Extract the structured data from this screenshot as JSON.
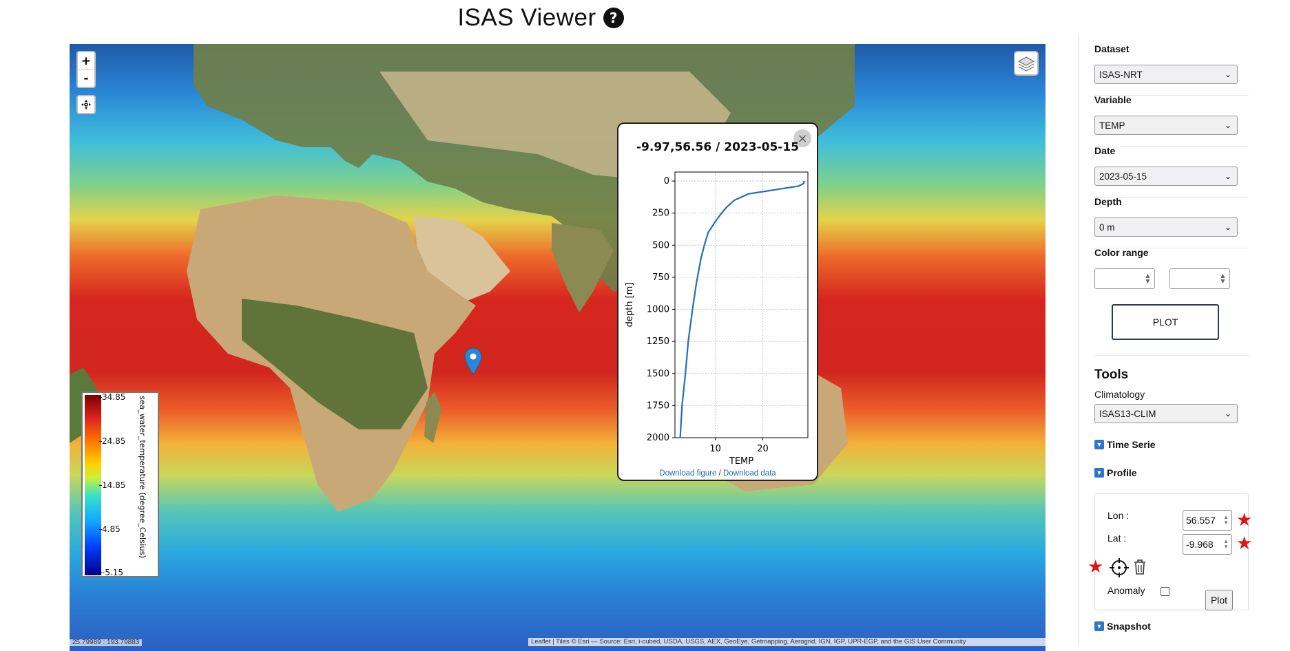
{
  "header": {
    "title": "ISAS Viewer",
    "help_icon": "?"
  },
  "map": {
    "zoom_in": "+",
    "zoom_out": "-",
    "legend": {
      "variable_label": "sea_water_temperature (degree_Celsius)",
      "ticks": [
        "34.85",
        "24.85",
        "14.85",
        "4.85",
        "-5.15"
      ]
    },
    "popup": {
      "title": "-9.97,56.56 / 2023-05-15",
      "close": "×",
      "xlabel": "TEMP",
      "ylabel": "depth [m]",
      "download_figure": "Download figure",
      "separator": " / ",
      "download_data": "Download data"
    },
    "coords_readout": "25.79989 : 193.79883",
    "attribution": "Leaflet | Tiles © Esri — Source: Esri, i-cubed, USDA, USGS, AEX, GeoEye, Getmapping, Aerogrid, IGN, IGP, UPR-EGP, and the GIS User Community"
  },
  "chart_data": {
    "type": "line",
    "title": "",
    "xlabel": "TEMP",
    "ylabel": "depth [m]",
    "x_ticks": [
      "10",
      "20"
    ],
    "y_ticks": [
      "0",
      "250",
      "500",
      "750",
      "1000",
      "1250",
      "1500",
      "1750",
      "2000"
    ],
    "xlim": [
      1.5,
      29.5
    ],
    "ylim": [
      2000,
      -70
    ],
    "y_inverted": true,
    "grid": true,
    "series": [
      {
        "x": [
          28.7,
          28.6,
          27.5,
          24.0,
          20.5,
          17.0,
          15.5,
          14.0,
          12.5,
          11.3,
          10.3,
          9.4,
          8.5,
          7.7,
          7.0,
          6.0,
          5.2,
          4.3,
          3.7,
          3.0,
          2.6
        ],
        "y": [
          0,
          20,
          40,
          60,
          80,
          100,
          125,
          150,
          200,
          250,
          300,
          350,
          400,
          500,
          600,
          800,
          1000,
          1250,
          1500,
          1750,
          2000
        ]
      }
    ]
  },
  "sidebar": {
    "dataset_label": "Dataset",
    "dataset_value": "ISAS-NRT",
    "variable_label": "Variable",
    "variable_value": "TEMP",
    "date_label": "Date",
    "date_value": "2023-05-15",
    "depth_label": "Depth",
    "depth_value": "0 m",
    "color_range_label": "Color range",
    "plot_label": "PLOT",
    "tools_title": "Tools",
    "climatology_label": "Climatology",
    "climatology_value": "ISAS13-CLIM",
    "time_serie_label": "Time Serie",
    "profile_label": "Profile",
    "lon_label": "Lon :",
    "lon_value": "56.557",
    "lat_label": "Lat :",
    "lat_value": "-9.968",
    "anomaly_label": "Anomaly",
    "profile_plot_label": "Plot",
    "snapshot_label": "Snapshot"
  }
}
